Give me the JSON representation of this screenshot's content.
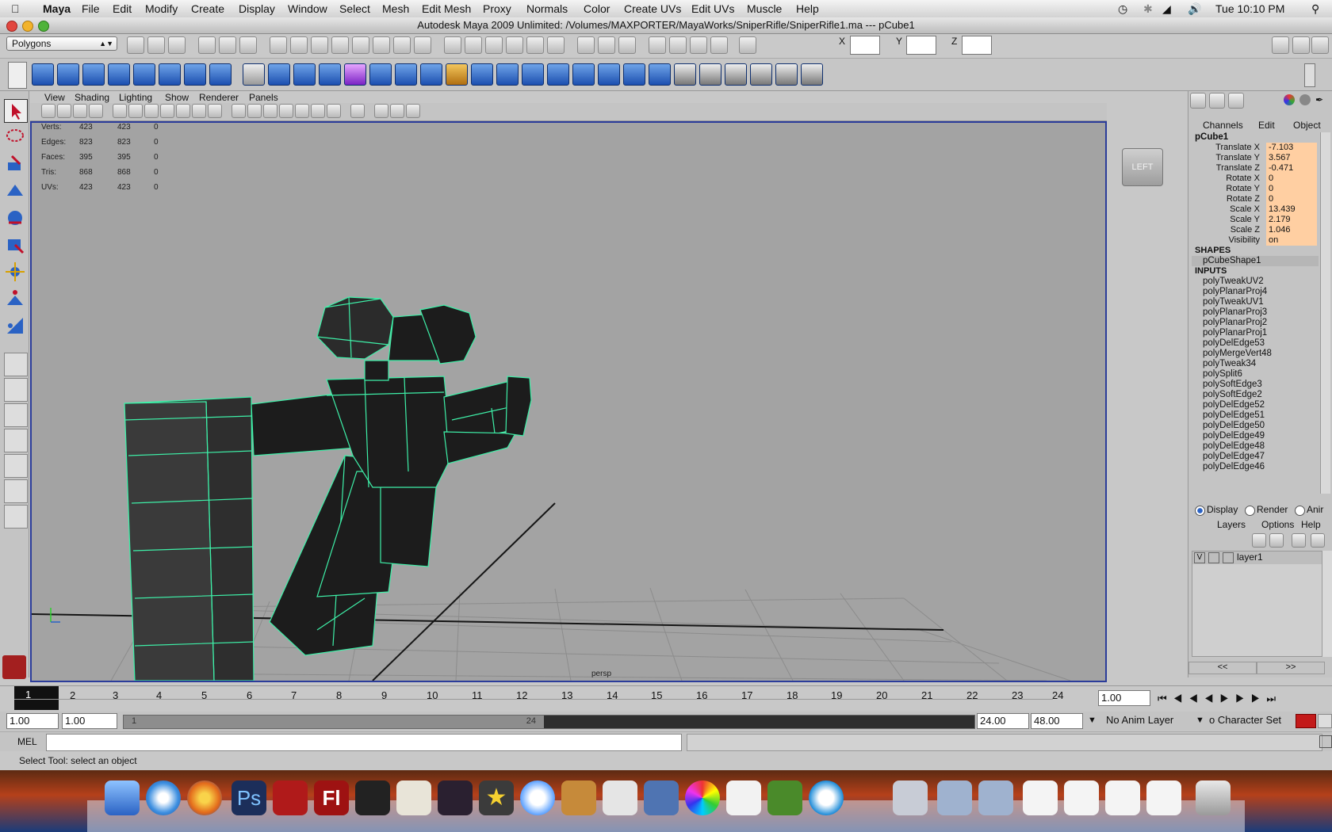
{
  "menubar": {
    "app": "Maya",
    "items": [
      "File",
      "Edit",
      "Modify",
      "Create",
      "Display",
      "Window",
      "Select",
      "Mesh",
      "Edit Mesh",
      "Proxy",
      "Normals",
      "Color",
      "Create UVs",
      "Edit UVs",
      "Muscle",
      "Help"
    ],
    "clock": "Tue 10:10 PM"
  },
  "window": {
    "title": "Autodesk Maya 2009 Unlimited: /Volumes/MAXPORTER/MayaWorks/SniperRifle/SniperRifle1.ma   ---   pCube1"
  },
  "statusline": {
    "mode": "Polygons",
    "x_label": "X",
    "y_label": "Y",
    "z_label": "Z",
    "x_value": "",
    "y_value": "",
    "z_value": ""
  },
  "panel_menu": [
    "View",
    "Shading",
    "Lighting",
    "Show",
    "Renderer",
    "Panels"
  ],
  "hud": {
    "rows": [
      {
        "label": "Verts:",
        "a": "423",
        "b": "423",
        "c": "0"
      },
      {
        "label": "Edges:",
        "a": "823",
        "b": "823",
        "c": "0"
      },
      {
        "label": "Faces:",
        "a": "395",
        "b": "395",
        "c": "0"
      },
      {
        "label": "Tris:",
        "a": "868",
        "b": "868",
        "c": "0"
      },
      {
        "label": "UVs:",
        "a": "423",
        "b": "423",
        "c": "0"
      }
    ],
    "camera": "persp",
    "viewcube": "LEFT"
  },
  "channelbox": {
    "tabs": [
      "Channels",
      "Edit",
      "Object"
    ],
    "object": "pCube1",
    "attributes": [
      {
        "name": "Translate X",
        "value": "-7.103"
      },
      {
        "name": "Translate Y",
        "value": "3.567"
      },
      {
        "name": "Translate Z",
        "value": "-0.471"
      },
      {
        "name": "Rotate X",
        "value": "0"
      },
      {
        "name": "Rotate Y",
        "value": "0"
      },
      {
        "name": "Rotate Z",
        "value": "0"
      },
      {
        "name": "Scale X",
        "value": "13.439"
      },
      {
        "name": "Scale Y",
        "value": "2.179"
      },
      {
        "name": "Scale Z",
        "value": "1.046"
      },
      {
        "name": "Visibility",
        "value": "on"
      }
    ],
    "shapes_header": "SHAPES",
    "shape": "pCubeShape1",
    "inputs_header": "INPUTS",
    "inputs": [
      "polyTweakUV2",
      "polyPlanarProj4",
      "polyTweakUV1",
      "polyPlanarProj3",
      "polyPlanarProj2",
      "polyPlanarProj1",
      "polyDelEdge53",
      "polyMergeVert48",
      "polyTweak34",
      "polySplit6",
      "polySoftEdge3",
      "polySoftEdge2",
      "polyDelEdge52",
      "polyDelEdge51",
      "polyDelEdge50",
      "polyDelEdge49",
      "polyDelEdge48",
      "polyDelEdge47",
      "polyDelEdge46"
    ]
  },
  "layers": {
    "radios": [
      "Display",
      "Render",
      "Anir"
    ],
    "menu": [
      "Layers",
      "Options",
      "Help"
    ],
    "nav_prev": "<<",
    "nav_next": ">>",
    "row": {
      "vis": "V",
      "name": "layer1"
    }
  },
  "timeline": {
    "ticks": [
      "1",
      "2",
      "3",
      "4",
      "5",
      "6",
      "7",
      "8",
      "9",
      "10",
      "11",
      "12",
      "13",
      "14",
      "15",
      "16",
      "17",
      "18",
      "19",
      "20",
      "21",
      "22",
      "23",
      "24"
    ],
    "current": "1",
    "current_field": "1.00"
  },
  "range": {
    "start": "1.00",
    "start2": "1.00",
    "slider_start": "1",
    "slider_end": "24",
    "end": "24.00",
    "end2": "48.00",
    "anim_layer": "No Anim Layer",
    "char_set": "o Character Set"
  },
  "cmd": {
    "label": "MEL"
  },
  "help": {
    "text": "Select Tool: select an object"
  },
  "dock": {
    "icons": [
      "finder-icon",
      "safari-icon",
      "firefox-icon",
      "photoshop-icon",
      "maya-icon",
      "flash-icon",
      "unity-icon",
      "pen-icon",
      "warcraft-icon",
      "imovie-icon",
      "itunes-icon",
      "garageband-icon",
      "textedit-icon",
      "preview-icon",
      "iphoto-icon",
      "colorsync-icon",
      "stickies-icon",
      "lotus-icon",
      "quicktime-icon",
      "mail-icon",
      "folder-icon",
      "downloads-icon",
      "doc-icon",
      "doc2-icon",
      "doc3-icon",
      "doc4-icon",
      "trash-icon"
    ]
  },
  "colors": {
    "accent": "#2b3c9a",
    "wire": "#3ef0a8",
    "channel_value_bg": "#ffcfa2",
    "viewport_bg": "#a3a3a3"
  }
}
